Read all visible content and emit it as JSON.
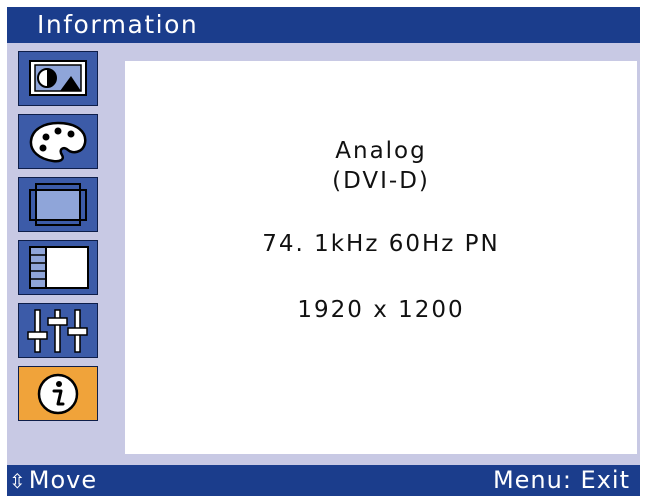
{
  "header": {
    "title": "Information"
  },
  "menu": {
    "items": [
      {
        "name": "picture",
        "icon": "picture-icon",
        "active": false
      },
      {
        "name": "color",
        "icon": "palette-icon",
        "active": false
      },
      {
        "name": "geometry",
        "icon": "screen-size-icon",
        "active": false
      },
      {
        "name": "osd-position",
        "icon": "osd-layout-icon",
        "active": false
      },
      {
        "name": "setup",
        "icon": "sliders-icon",
        "active": false
      },
      {
        "name": "information",
        "icon": "info-icon",
        "active": true
      }
    ]
  },
  "info": {
    "signal_type": "Analog",
    "input": "(DVI-D)",
    "frequency": "74. 1kHz  60Hz  PN",
    "resolution": "1920 x 1200"
  },
  "footer": {
    "move_arrow": "⇳",
    "move_label": "Move",
    "exit_label": "Menu: Exit"
  },
  "colors": {
    "bar": "#1b3d8c",
    "panel": "#c8c9e4",
    "icon_bg": "#3c5ba8",
    "active_icon_bg": "#f0a33a"
  }
}
